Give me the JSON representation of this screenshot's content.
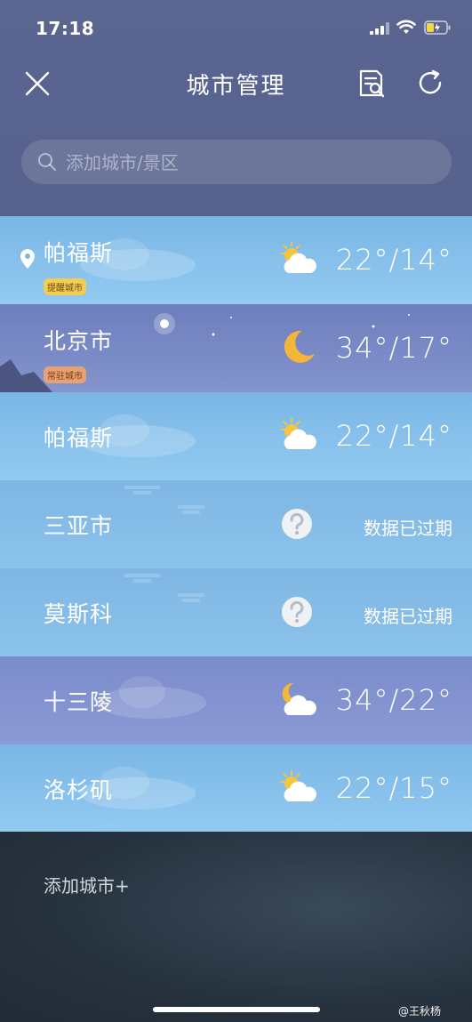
{
  "status": {
    "time": "17:18"
  },
  "nav": {
    "title": "城市管理"
  },
  "search": {
    "placeholder": "添加城市/景区"
  },
  "cities": [
    {
      "name": "帕福斯",
      "badge": "提醒城市",
      "weather": "partly-cloudy-day-icon",
      "temp": "22°/14°"
    },
    {
      "name": "北京市",
      "badge": "常驻城市",
      "weather": "crescent-moon-icon",
      "temp": "34°/17°"
    },
    {
      "name": "帕福斯",
      "weather": "partly-cloudy-day-icon",
      "temp": "22°/14°"
    },
    {
      "name": "三亚市",
      "weather": "question-icon",
      "status": "数据已过期"
    },
    {
      "name": "莫斯科",
      "weather": "question-icon",
      "status": "数据已过期"
    },
    {
      "name": "十三陵",
      "weather": "partly-cloudy-night-icon",
      "temp": "34°/22°"
    },
    {
      "name": "洛杉矶",
      "weather": "partly-cloudy-day-icon",
      "temp": "22°/15°"
    }
  ],
  "add_city": {
    "label": "添加城市+"
  },
  "watermark": "@王秋杨",
  "colors": {
    "header": "#5a6691",
    "day_row": "#85c0ec",
    "night_row": "#7686c5",
    "bottom": "#26323e"
  }
}
